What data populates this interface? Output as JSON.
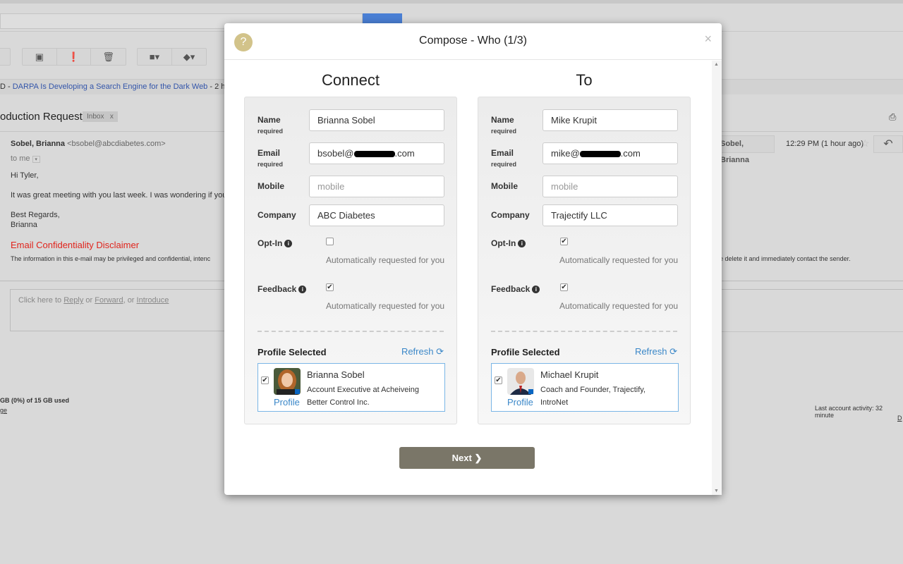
{
  "background": {
    "news_prefix": "D - ",
    "news_link": "DARPA Is Developing a Search Engine for the Dark Web",
    "news_suffix": " - 2 hours",
    "subject": "oduction Request",
    "label": "Inbox",
    "label_remove": "x",
    "sender_name": "Sobel, Brianna",
    "sender_email": "<bsobel@abcdiabetes.com>",
    "to": "to me",
    "greeting": "Hi Tyler,",
    "body": "It was great meeting with you last week. I was wondering if you cou",
    "signoff": "Best Regards,",
    "signname": "Brianna",
    "disclaimer_title": "Email Confidentiality Disclaimer",
    "disclaimer_left": "The information in this e-mail may be privileged and confidential, intenc",
    "disclaimer_right": "e delete it and immediately contact the sender.",
    "reply_prefix": "Click here to ",
    "reply": "Reply",
    "or1": " or ",
    "forward": "Forward",
    "or2": ", or ",
    "introduce": "Introduce",
    "storage": "GB (0%) of 15 GB used",
    "storage_link": "ge",
    "sender_chip": "Sobel, Brianna",
    "time": "12:29 PM (1 hour ago)",
    "activity": "Last account activity: 32 minute",
    "details": "D"
  },
  "modal": {
    "title": "Compose - Who (1/3)",
    "help": "?",
    "close": "×",
    "next": "Next",
    "labels": {
      "name": "Name",
      "email": "Email",
      "required": "required",
      "mobile": "Mobile",
      "company": "Company",
      "optin": "Opt-In",
      "feedback": "Feedback",
      "auto": "Automatically requested for you",
      "profile_selected": "Profile Selected",
      "refresh": "Refresh",
      "profile": "Profile"
    },
    "columns": [
      {
        "title": "Connect",
        "name": "Brianna Sobel",
        "email_prefix": "bsobel@",
        "email_suffix": ".com",
        "mobile_placeholder": "mobile",
        "company": "ABC Diabetes",
        "optin": false,
        "feedback": true,
        "profile_checked": true,
        "profile_name": "Brianna Sobel",
        "profile_desc": "Account Executive at Acheiveing Better Control Inc."
      },
      {
        "title": "To",
        "name": "Mike Krupit",
        "email_prefix": "mike@",
        "email_suffix": ".com",
        "mobile_placeholder": "mobile",
        "company": "Trajectify LLC",
        "optin": true,
        "feedback": true,
        "profile_checked": true,
        "profile_name": "Michael Krupit",
        "profile_desc": "Coach and Founder, Trajectify, IntroNet"
      }
    ]
  },
  "colors": {
    "accent": "#3a87c8",
    "next_button": "#7a7668",
    "help": "#d2c38a",
    "disclaimer": "#e0241c"
  }
}
